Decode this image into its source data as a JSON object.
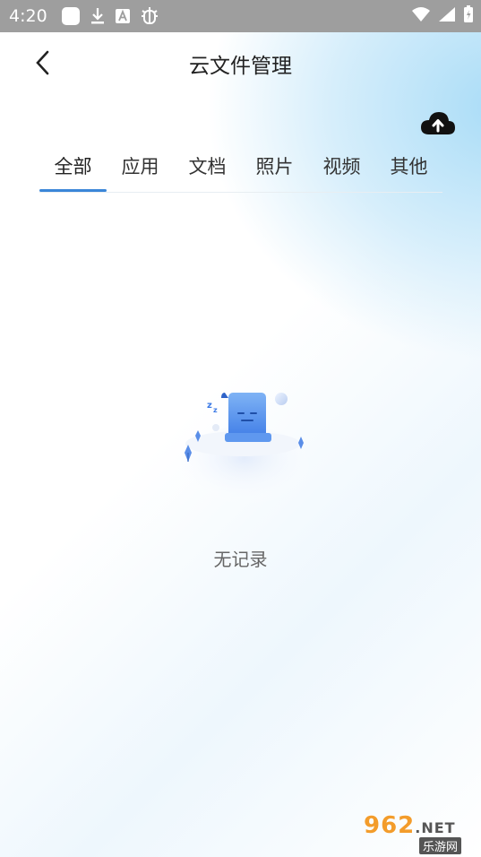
{
  "status_bar": {
    "time": "4:20",
    "icons": [
      "app-square-icon",
      "download-icon",
      "a-box-icon",
      "bug-icon",
      "wifi-icon",
      "signal-icon",
      "battery-icon"
    ]
  },
  "header": {
    "title": "云文件管理",
    "back_icon": "back-arrow-icon",
    "upload_icon": "cloud-upload-icon"
  },
  "tabs": [
    {
      "label": "全部",
      "selected": true
    },
    {
      "label": "应用",
      "selected": false
    },
    {
      "label": "文档",
      "selected": false
    },
    {
      "label": "照片",
      "selected": false
    },
    {
      "label": "视频",
      "selected": false
    },
    {
      "label": "其他",
      "selected": false
    }
  ],
  "empty_state": {
    "text": "无记录"
  },
  "watermark": {
    "brand": "962",
    "suffix": ".NET",
    "subtitle": "乐游网"
  },
  "colors": {
    "accent": "#3b86d8",
    "status_bar": "#9e9e9e"
  }
}
